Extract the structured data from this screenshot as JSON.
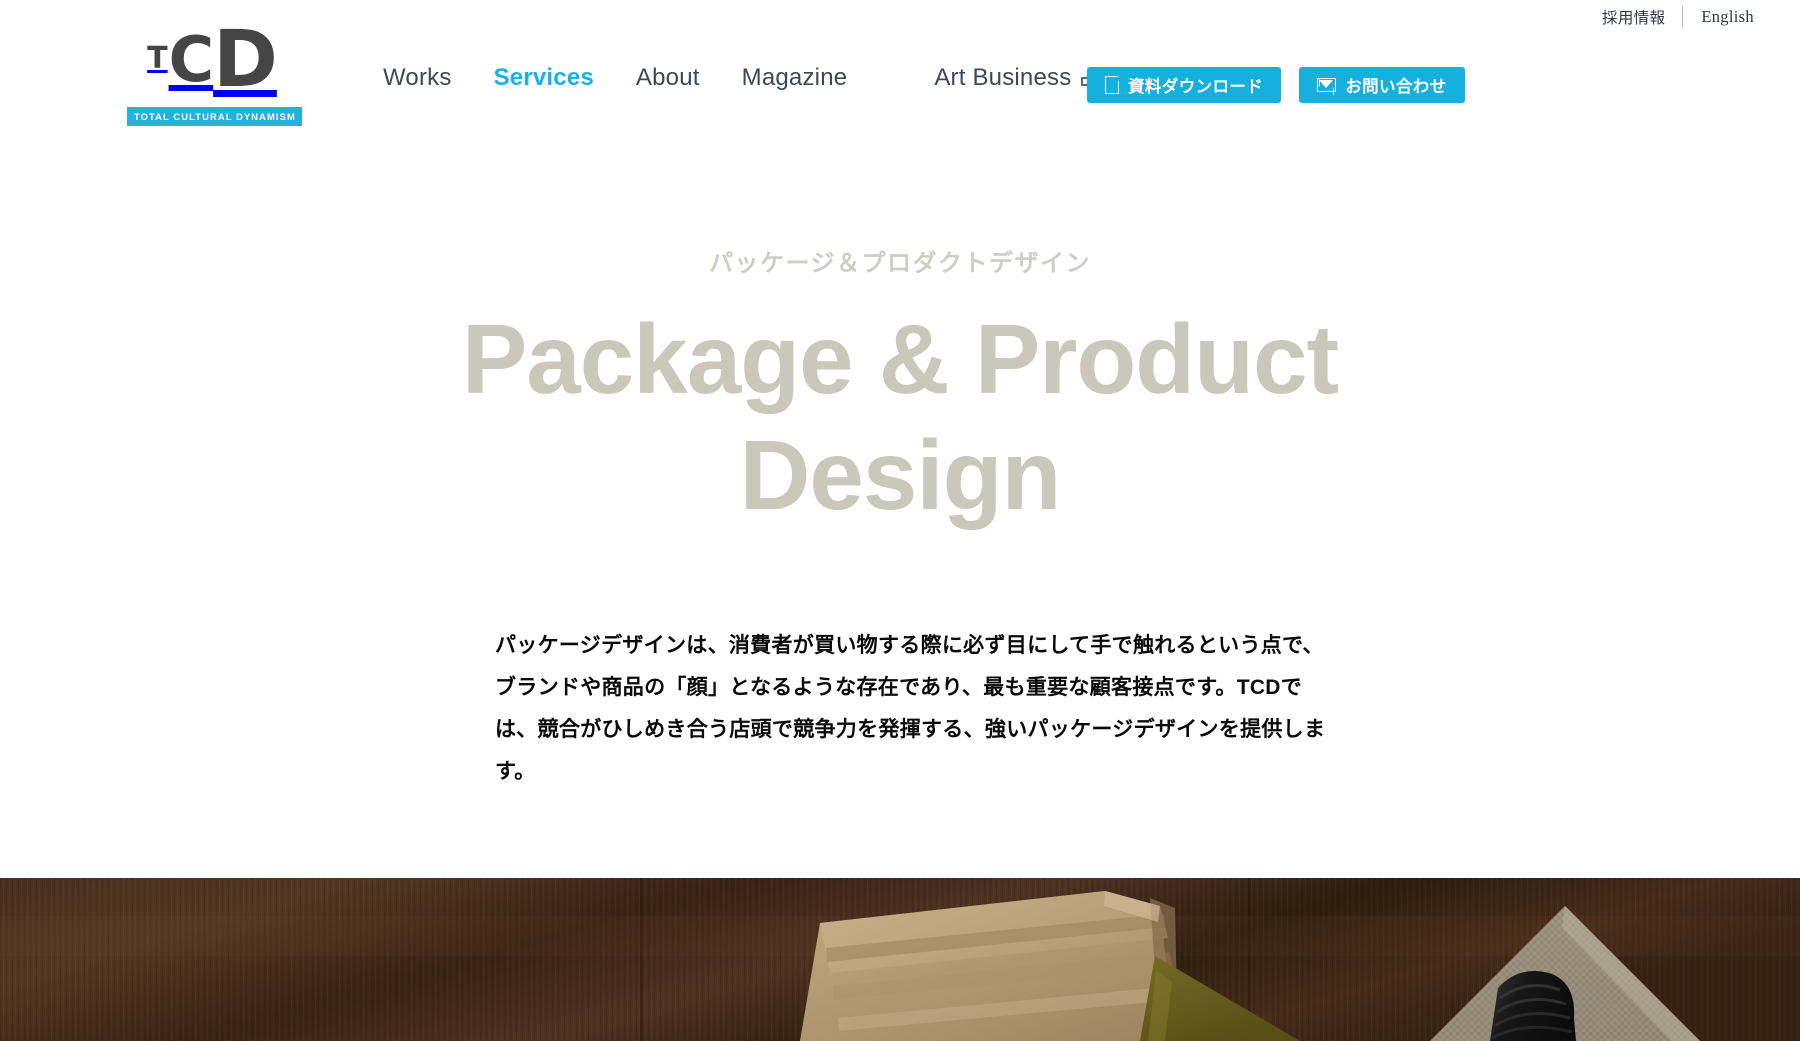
{
  "brand": {
    "logo_t": "T",
    "logo_c": "C",
    "logo_d": "D",
    "tagline": "TOTAL CULTURAL DYNAMISM",
    "accent_color": "#16b3e8",
    "logo_mark_color": "#454545"
  },
  "utility": {
    "recruit_label": "採用情報",
    "english_label": "English"
  },
  "nav": {
    "items": [
      {
        "label": "Works",
        "active": false
      },
      {
        "label": "Services",
        "active": true
      },
      {
        "label": "About",
        "active": false
      },
      {
        "label": "Magazine",
        "active": false
      }
    ],
    "external": {
      "label": "Art Business",
      "icon": "external-link-icon"
    }
  },
  "header_cta": [
    {
      "label": "資料ダウンロード",
      "icon": "document-icon",
      "bg": "#16b0de"
    },
    {
      "label": "お問い合わせ",
      "icon": "mail-icon",
      "bg": "#16b0de"
    }
  ],
  "hero": {
    "subtitle": "パッケージ＆プロダクトデザイン",
    "title": "Package & Product Design",
    "title_color": "#c9c8bb",
    "subtitle_color": "#cfcec3",
    "body": "パッケージデザインは、消費者が買い物する際に必ず目にして手で触れるという点で、ブランドや商品の「顔」となるような存在であり、最も重要な顧客接点です。TCDでは、競合がひしめき合う店頭で競争力を発揮する、強いパッケージデザインを提供します。"
  },
  "photo": {
    "alt": "ダークな木製テーブルの上に置かれたクラフト紙のパッケージ袋、オリーブ色の布、麻布と黒い容器",
    "wood_color": "#4a2f1d",
    "kraft_color": "#c3a87d",
    "olive_color": "#6e6420",
    "burlap_color": "#a99f8c",
    "black_object_color": "#1c1c1c"
  }
}
